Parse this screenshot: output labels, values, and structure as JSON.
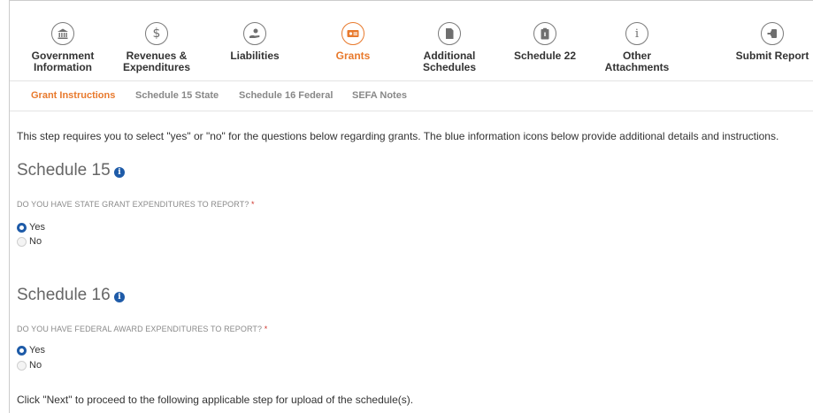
{
  "steps": [
    {
      "label": "Government Information",
      "icon": "bank-icon",
      "active": false
    },
    {
      "label": "Revenues & Expenditures",
      "icon": "dollar-icon",
      "active": false
    },
    {
      "label": "Liabilities",
      "icon": "hand-coin-icon",
      "active": false
    },
    {
      "label": "Grants",
      "icon": "money-bill-icon",
      "active": true
    },
    {
      "label": "Additional Schedules",
      "icon": "document-icon",
      "active": false
    },
    {
      "label": "Schedule 22",
      "icon": "clipboard-icon",
      "active": false
    },
    {
      "label": "Other Attachments",
      "icon": "info-icon",
      "active": false
    },
    {
      "label": "Submit Report",
      "icon": "submit-icon",
      "active": false
    }
  ],
  "subtabs": [
    {
      "label": "Grant Instructions",
      "active": true
    },
    {
      "label": "Schedule 15 State",
      "active": false
    },
    {
      "label": "Schedule 16 Federal",
      "active": false
    },
    {
      "label": "SEFA Notes",
      "active": false
    }
  ],
  "intro": "This step requires you to select \"yes\" or \"no\" for the questions below regarding grants. The blue information icons below provide additional details and instructions.",
  "schedule15": {
    "title": "Schedule 15",
    "question": "DO YOU HAVE STATE GRANT EXPENDITURES TO REPORT?",
    "required": "*",
    "yes_label": "Yes",
    "no_label": "No",
    "selected": "Yes"
  },
  "schedule16": {
    "title": "Schedule 16",
    "question": "DO YOU HAVE FEDERAL AWARD EXPENDITURES TO REPORT?",
    "required": "*",
    "yes_label": "Yes",
    "no_label": "No",
    "selected": "Yes"
  },
  "footer": "Click \"Next\" to proceed to the following applicable step for upload of the schedule(s).",
  "colors": {
    "accent": "#e8792c",
    "info": "#1e5ba8",
    "required": "#d0342c"
  }
}
